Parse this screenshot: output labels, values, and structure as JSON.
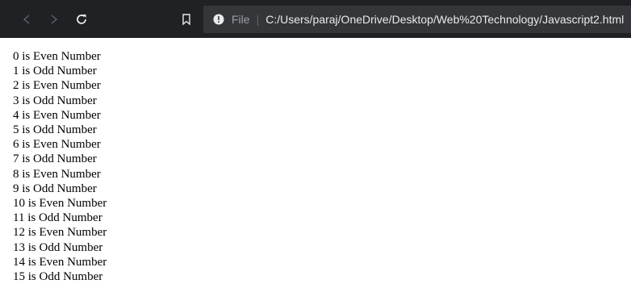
{
  "browser": {
    "file_label": "File",
    "separator": "|",
    "url": "C:/Users/paraj/OneDrive/Desktop/Web%20Technology/Javascript2.html",
    "icons": {
      "back": "back-arrow-icon",
      "forward": "forward-arrow-icon",
      "reload": "reload-icon",
      "bookmark": "bookmark-icon",
      "info": "info-icon"
    },
    "colors": {
      "toolbar_bg": "#202124",
      "omnibox_bg": "#35363a"
    }
  },
  "page": {
    "lines": [
      "0 is Even Number",
      "1 is Odd Number",
      "2 is Even Number",
      "3 is Odd Number",
      "4 is Even Number",
      "5 is Odd Number",
      "6 is Even Number",
      "7 is Odd Number",
      "8 is Even Number",
      "9 is Odd Number",
      "10 is Even Number",
      "11 is Odd Number",
      "12 is Even Number",
      "13 is Odd Number",
      "14 is Even Number",
      "15 is Odd Number"
    ]
  }
}
